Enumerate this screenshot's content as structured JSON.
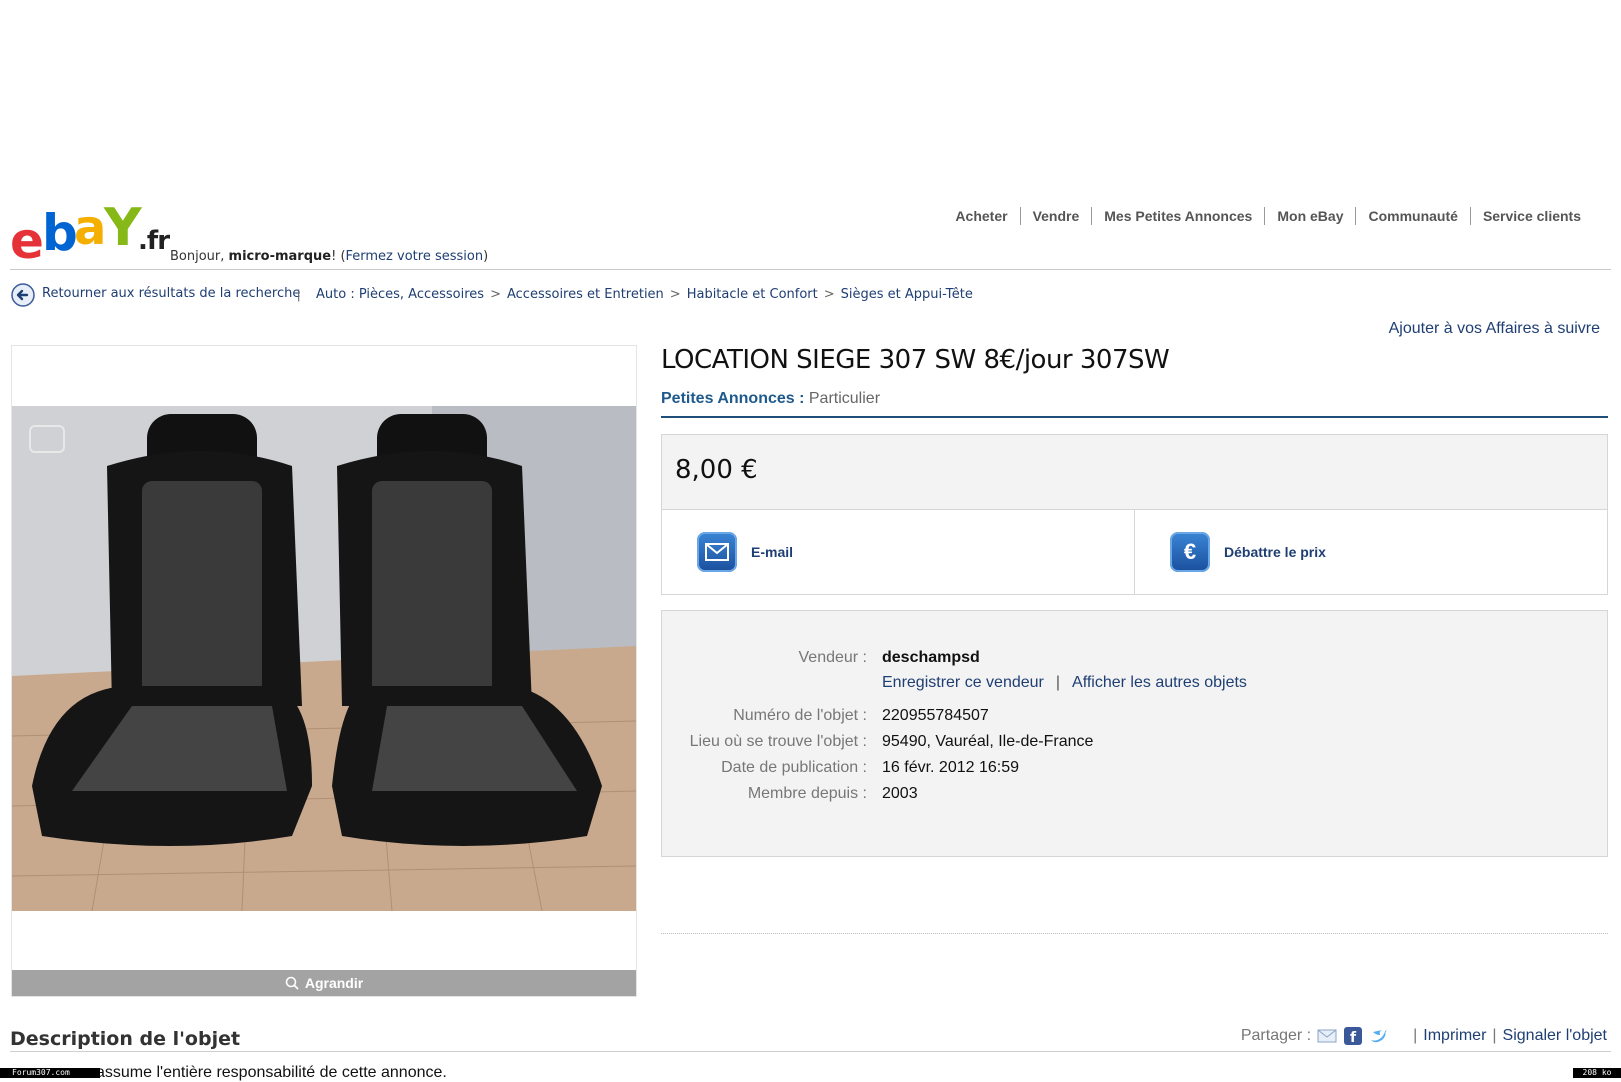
{
  "header": {
    "logo_text": "ebaY.fr",
    "greeting_prefix": "Bonjour, ",
    "username": "micro-marque",
    "greeting_suffix": "! (",
    "signout": "Fermez votre session",
    "greeting_end": ")",
    "nav": [
      "Acheter",
      "Vendre",
      "Mes Petites Annonces",
      "Mon eBay",
      "Communauté",
      "Service clients"
    ]
  },
  "breadcrumb": {
    "back": "Retourner aux résultats de la recherche",
    "separator": "|",
    "items": [
      "Auto : Pièces, Accessoires",
      "Accessoires et Entretien",
      "Habitacle et Confort",
      "Sièges et Appui-Tête"
    ]
  },
  "image_panel": {
    "enlarge": "Agrandir"
  },
  "listing": {
    "watch": "Ajouter à vos Affaires à suivre",
    "title": "LOCATION SIEGE 307 SW 8€/jour 307SW",
    "category_label": "Petites Annonces :",
    "category_value": " Particulier",
    "price": "8,00 €",
    "email_label": "E-mail",
    "offer_label": "Débattre le prix"
  },
  "seller": {
    "vendor_label": "Vendeur :",
    "vendor": "deschampsd",
    "save_seller": "Enregistrer ce vendeur",
    "sep": "|",
    "other_items": "Afficher les autres objets",
    "item_no_label": "Numéro de l'objet :",
    "item_no": "220955784507",
    "location_label": "Lieu où se trouve l'objet :",
    "location": "95490, Vauréal, Ile-de-France",
    "published_label": "Date de publication :",
    "published": "16 févr. 2012 16:59",
    "member_label": "Membre depuis :",
    "member": "2003"
  },
  "description": {
    "title": "Description de l'objet",
    "share_label": "Partager :",
    "print": "Imprimer",
    "report": "Signaler l'objet",
    "sep": "|",
    "text": "assume l'entière responsabilité de cette annonce."
  },
  "watermark": {
    "left": "Forum307.com",
    "right": "208 ko"
  }
}
